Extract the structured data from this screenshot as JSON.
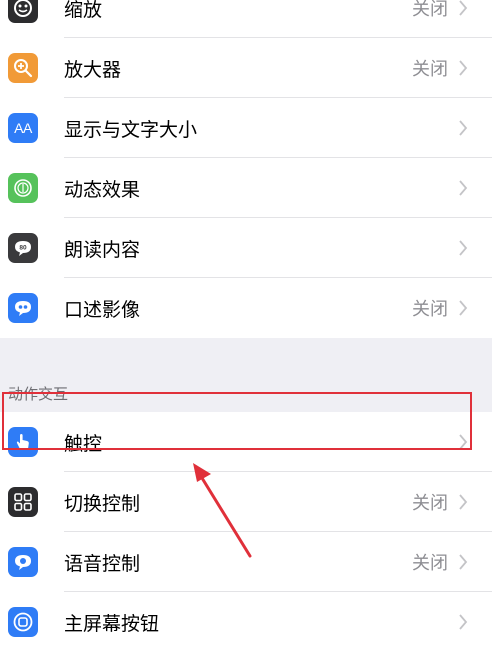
{
  "group1": {
    "items": [
      {
        "label": "缩放",
        "value": "关闭",
        "icon": "zoom-icon",
        "color": "#2c2c2e"
      },
      {
        "label": "放大器",
        "value": "关闭",
        "icon": "magnifier-icon",
        "color": "#f19a37"
      },
      {
        "label": "显示与文字大小",
        "value": "",
        "icon": "text-size-icon",
        "color": "#2f7cf6",
        "icon_text": "AA"
      },
      {
        "label": "动态效果",
        "value": "",
        "icon": "motion-icon",
        "color": "#56c25b"
      },
      {
        "label": "朗读内容",
        "value": "",
        "icon": "speech-icon",
        "color": "#3a3a3c"
      },
      {
        "label": "口述影像",
        "value": "关闭",
        "icon": "audio-description-icon",
        "color": "#2f7cf6"
      }
    ]
  },
  "section2": {
    "header": "动作交互",
    "items": [
      {
        "label": "触控",
        "value": "",
        "icon": "touch-hand-icon",
        "color": "#2f7cf6"
      },
      {
        "label": "切换控制",
        "value": "关闭",
        "icon": "switch-control-icon",
        "color": "#2c2c2e"
      },
      {
        "label": "语音控制",
        "value": "关闭",
        "icon": "voice-control-icon",
        "color": "#2f7cf6"
      },
      {
        "label": "主屏幕按钮",
        "value": "",
        "icon": "home-button-icon",
        "color": "#2f7cf6"
      }
    ]
  },
  "annotation": {
    "highlight_color": "#e0303a"
  }
}
